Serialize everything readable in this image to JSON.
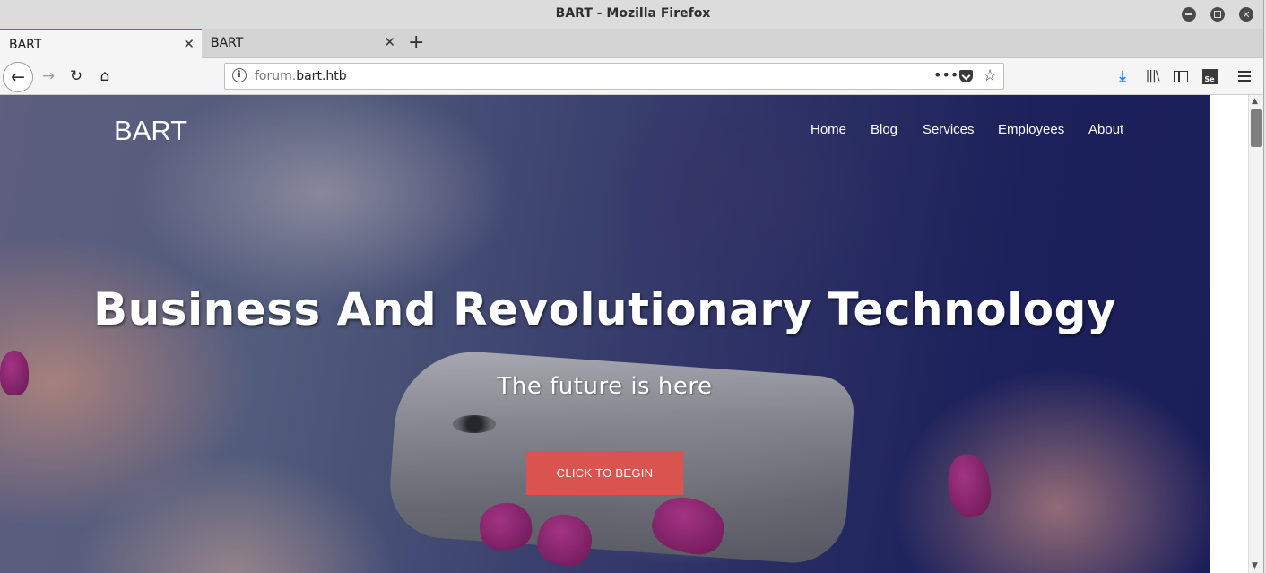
{
  "window": {
    "title": "BART - Mozilla Firefox"
  },
  "tabs": [
    {
      "label": "BART",
      "active": true
    },
    {
      "label": "BART",
      "active": false
    }
  ],
  "toolbar": {
    "url_host_prefix": "forum.",
    "url_host_main": "bart.htb",
    "page_actions": "•••"
  },
  "site": {
    "brand": "BART",
    "nav": [
      "Home",
      "Blog",
      "Services",
      "Employees",
      "About"
    ],
    "headline": "Business And Revolutionary Technology",
    "subheadline": "The future is here",
    "cta": "CLICK TO BEGIN"
  },
  "colors": {
    "accent": "#d9534f",
    "tab_highlight": "#0a84ff",
    "hero_dark": "#1c2060"
  }
}
